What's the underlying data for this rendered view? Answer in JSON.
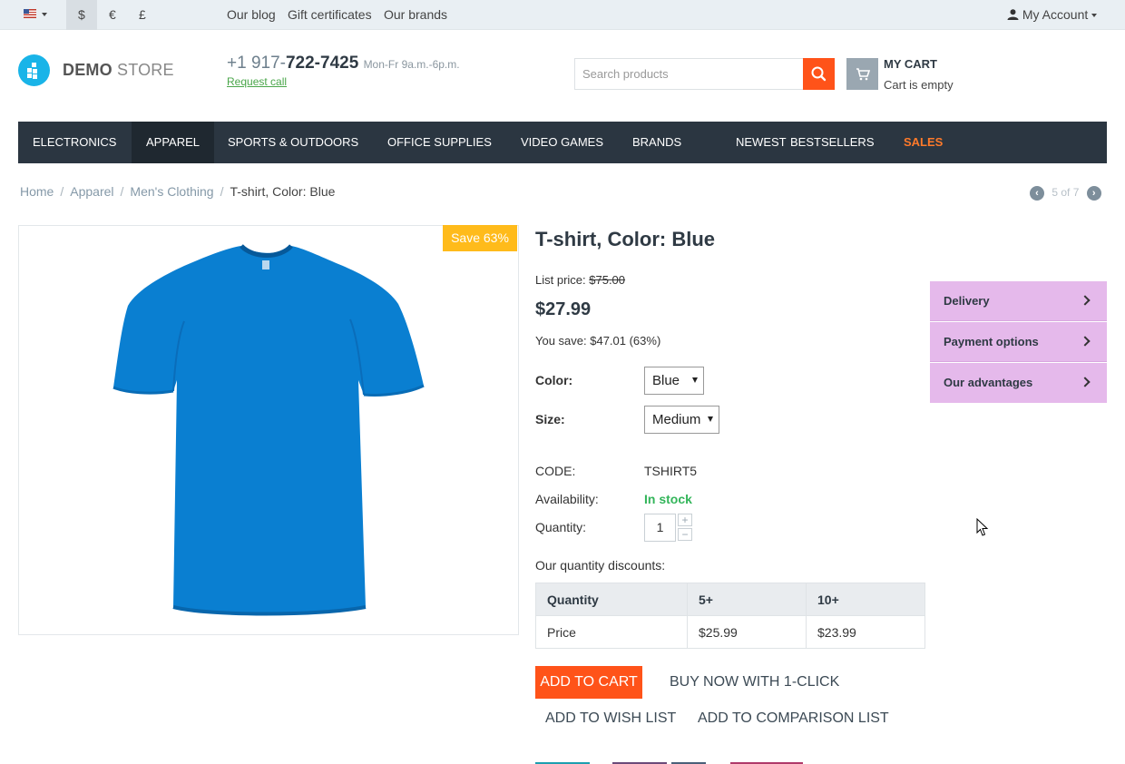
{
  "topbar": {
    "currency": [
      "$",
      "€",
      "£"
    ],
    "links": [
      "Our blog",
      "Gift certificates",
      "Our brands"
    ],
    "account": "My Account"
  },
  "header": {
    "logo_bold": "DEMO",
    "logo_light": " STORE",
    "phone_prefix": "+1 917-",
    "phone_main": "722-7425",
    "hours": "Mon-Fr 9a.m.-6p.m.",
    "request_call": "Request call",
    "search_placeholder": "Search products",
    "cart_title": "MY CART",
    "cart_status": "Cart is empty"
  },
  "nav": {
    "items": [
      "ELECTRONICS",
      "APPAREL",
      "SPORTS & OUTDOORS",
      "OFFICE SUPPLIES",
      "VIDEO GAMES",
      "BRANDS",
      "NEWEST",
      "BESTSELLERS",
      "SALES"
    ]
  },
  "breadcrumb": [
    "Home",
    "Apparel",
    "Men's Clothing",
    "T-shirt, Color: Blue"
  ],
  "pager": "5 of 7",
  "product": {
    "badge": "Save 63%",
    "title": "T-shirt, Color: Blue",
    "list_price_label": "List price: ",
    "list_price": "$75.00",
    "price": "$27.99",
    "you_save": "You save: $47.01 (63%)",
    "color_label": "Color:",
    "color_value": "Blue",
    "size_label": "Size:",
    "size_value": "Medium",
    "code_label": "CODE:",
    "code_value": "TSHIRT5",
    "availability_label": "Availability:",
    "availability_value": "In stock",
    "quantity_label": "Quantity:",
    "quantity_value": "1",
    "discounts_label": "Our quantity discounts:",
    "discount_table": {
      "header": [
        "Quantity",
        "5+",
        "10+"
      ],
      "row": [
        "Price",
        "$25.99",
        "$23.99"
      ]
    },
    "add_to_cart": "ADD TO CART",
    "buy_now": "BUY NOW WITH 1-CLICK",
    "wish_list": "ADD TO WISH LIST",
    "comparison": "ADD TO COMPARISON LIST",
    "shirt_color": "#0a7fd1"
  },
  "info_panel": [
    "Delivery",
    "Payment options",
    "Our advantages"
  ],
  "colors": {
    "accent": "#ff5319",
    "nav_bg": "#2b3641",
    "badge": "#ffbb1b",
    "panel": "#e5b9eb",
    "in_stock": "#33b55a",
    "sales": "#ff7a2a"
  }
}
